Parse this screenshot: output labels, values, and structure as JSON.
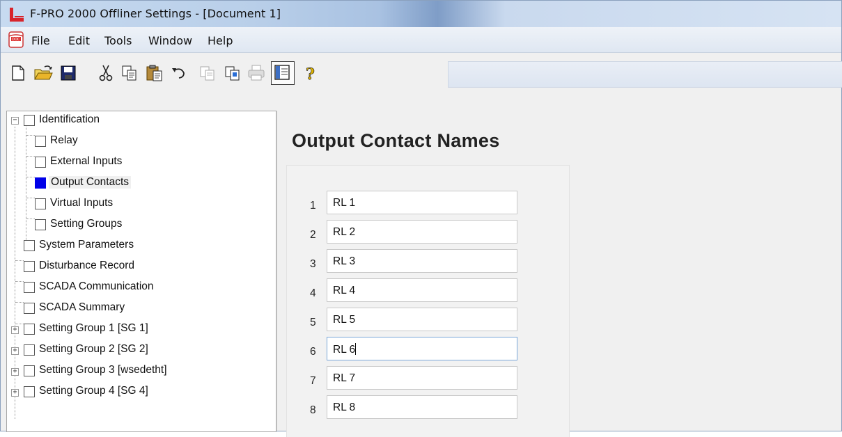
{
  "window": {
    "title": "F-PRO 2000 Offliner Settings - [Document 1]"
  },
  "menu": {
    "items": [
      "File",
      "Edit",
      "Tools",
      "Window",
      "Help"
    ]
  },
  "toolbar": {
    "buttons": [
      "new-icon",
      "open-icon",
      "save-icon",
      "cut-icon",
      "copy-icon",
      "paste-icon",
      "undo-icon",
      "copy-disabled-icon",
      "copy-special-icon",
      "print-icon",
      "view-pane-icon",
      "help-icon"
    ]
  },
  "tree": {
    "items": [
      {
        "label": "Identification"
      },
      {
        "label": "Relay"
      },
      {
        "label": "External Inputs"
      },
      {
        "label": "Output Contacts"
      },
      {
        "label": "Virtual Inputs"
      },
      {
        "label": "Setting Groups"
      },
      {
        "label": "System Parameters"
      },
      {
        "label": "Disturbance Record"
      },
      {
        "label": "SCADA Communication"
      },
      {
        "label": "SCADA Summary"
      },
      {
        "label": "Setting Group 1 [SG 1]"
      },
      {
        "label": "Setting Group 2 [SG 2]"
      },
      {
        "label": "Setting Group 3 [wsedetht]"
      },
      {
        "label": "Setting Group 4 [SG 4]"
      }
    ],
    "selected": "Output Contacts",
    "selected_color": "#0000e8"
  },
  "main": {
    "title": "Output Contact Names",
    "rows": [
      {
        "num": "1",
        "value": "RL 1"
      },
      {
        "num": "2",
        "value": "RL 2"
      },
      {
        "num": "3",
        "value": "RL 3"
      },
      {
        "num": "4",
        "value": "RL 4"
      },
      {
        "num": "5",
        "value": "RL 5"
      },
      {
        "num": "6",
        "value": "RL 6"
      },
      {
        "num": "7",
        "value": "RL 7"
      },
      {
        "num": "8",
        "value": "RL 8"
      }
    ],
    "focused_row": "6"
  }
}
